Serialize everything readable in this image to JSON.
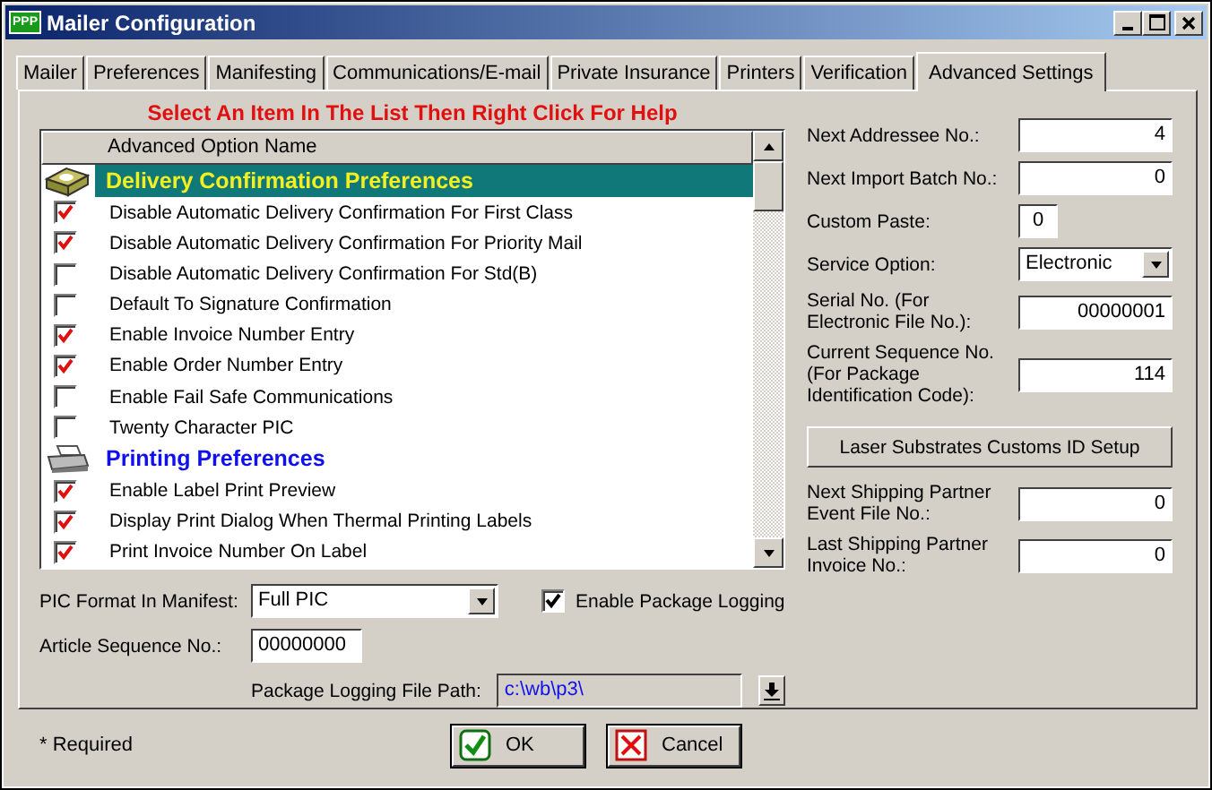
{
  "window": {
    "title": "Mailer Configuration",
    "app_icon_text": "PPP"
  },
  "tabs": [
    {
      "label": "Mailer",
      "selected": false
    },
    {
      "label": "Preferences",
      "selected": false
    },
    {
      "label": "Manifesting",
      "selected": false
    },
    {
      "label": "Communications/E-mail",
      "selected": false
    },
    {
      "label": "Private Insurance",
      "selected": false
    },
    {
      "label": "Printers",
      "selected": false
    },
    {
      "label": "Verification",
      "selected": false
    },
    {
      "label": "Advanced Settings",
      "selected": true
    }
  ],
  "help_text": "Select An Item In The List Then Right Click For Help",
  "option_list": {
    "column": "Advanced Option Name",
    "groups": [
      {
        "title": "Delivery Confirmation Preferences",
        "kind": "package",
        "selected": true,
        "items": [
          {
            "label": "Disable Automatic Delivery Confirmation For First Class",
            "checked": true
          },
          {
            "label": "Disable Automatic Delivery Confirmation For Priority Mail",
            "checked": true
          },
          {
            "label": "Disable Automatic Delivery Confirmation For Std(B)",
            "checked": false
          },
          {
            "label": "Default To Signature Confirmation",
            "checked": false
          },
          {
            "label": "Enable Invoice Number Entry",
            "checked": true
          },
          {
            "label": "Enable Order Number Entry",
            "checked": true
          },
          {
            "label": "Enable Fail Safe Communications",
            "checked": false
          },
          {
            "label": "Twenty Character PIC",
            "checked": false
          }
        ]
      },
      {
        "title": "Printing Preferences",
        "kind": "printer",
        "selected": false,
        "items": [
          {
            "label": "Enable Label Print Preview",
            "checked": true
          },
          {
            "label": "Display Print Dialog When Thermal Printing Labels",
            "checked": true
          },
          {
            "label": "Print Invoice Number On Label",
            "checked": true
          }
        ]
      }
    ]
  },
  "pic_format": {
    "label": "PIC Format In Manifest:",
    "value": "Full PIC"
  },
  "article_sequence": {
    "label": "Article Sequence No.:",
    "value": "00000000"
  },
  "package_logging": {
    "label": "Enable Package Logging",
    "checked": true
  },
  "logging_path": {
    "label": "Package Logging File Path:",
    "value": "c:\\wb\\p3\\"
  },
  "fields": [
    {
      "kind": "input",
      "label": "Next Addressee No.:",
      "value": "4"
    },
    {
      "kind": "input",
      "label": "Next Import Batch No.:",
      "value": "0"
    },
    {
      "kind": "short",
      "label": "Custom Paste:",
      "value": "0"
    },
    {
      "kind": "select",
      "label": "Service Option:",
      "value": "Electronic"
    },
    {
      "kind": "input",
      "label": "Serial No.  (For Electronic File No.):",
      "value": "00000001"
    },
    {
      "kind": "input",
      "label": "Current Sequence No. (For Package Identification Code):",
      "value": "114"
    },
    {
      "kind": "button",
      "label": "Laser Substrates Customs ID Setup"
    },
    {
      "kind": "input",
      "label": "Next Shipping Partner Event File No.:",
      "value": "0"
    },
    {
      "kind": "input",
      "label": "Last Shipping Partner Invoice No.:",
      "value": "0"
    }
  ],
  "footnote": "* Required",
  "buttons": [
    {
      "kind": "ok",
      "label": "OK"
    },
    {
      "kind": "cancel",
      "label": "Cancel"
    }
  ]
}
